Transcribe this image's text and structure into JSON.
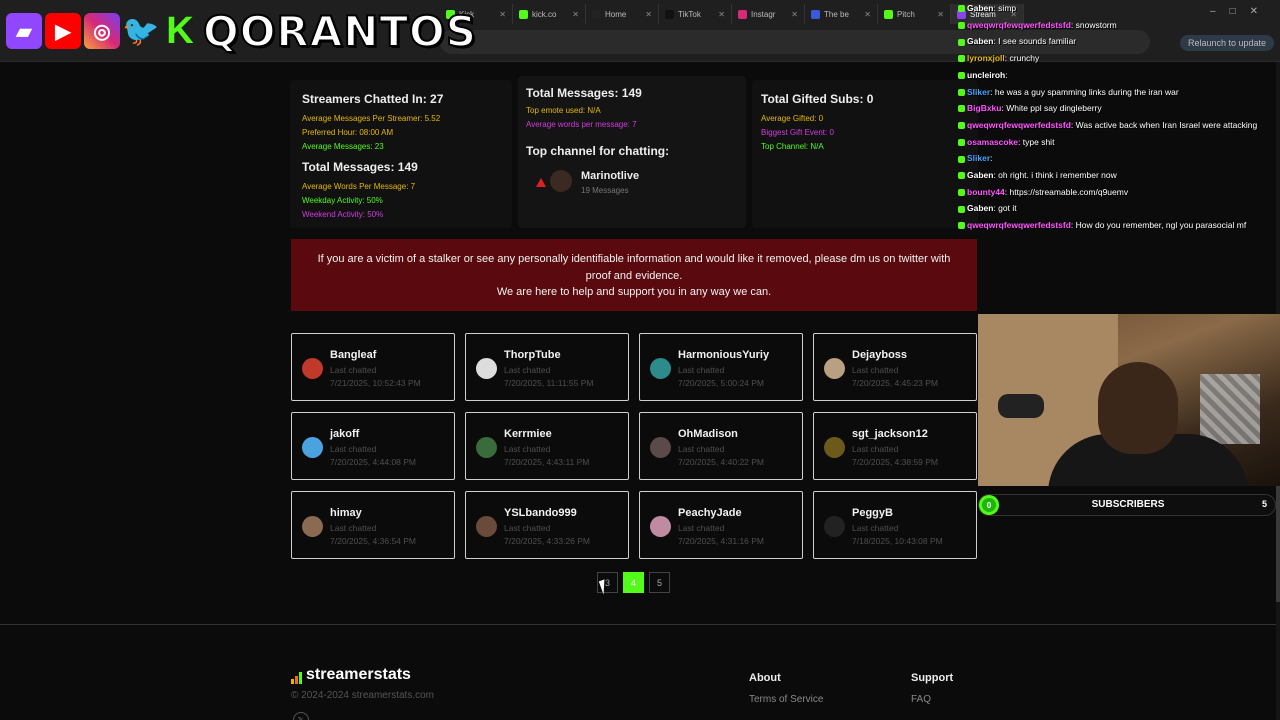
{
  "browser": {
    "tabs": [
      {
        "label": "Kick",
        "color": "#53fc18"
      },
      {
        "label": "kick.co",
        "color": "#53fc18"
      },
      {
        "label": "Home",
        "color": "#222222"
      },
      {
        "label": "TikTok",
        "color": "#111111"
      },
      {
        "label": "Instagr",
        "color": "#d62976"
      },
      {
        "label": "The be",
        "color": "#3a5bd9"
      },
      {
        "label": "Pitch",
        "color": "#53fc18"
      },
      {
        "label": "Stream",
        "color": "#8844ee"
      }
    ],
    "relaunch_label": "Relaunch to update"
  },
  "banner": {
    "handle": "QORANTOS",
    "icons": [
      "twitch-icon",
      "youtube-icon",
      "instagram-icon",
      "twitter-icon",
      "kick-icon"
    ]
  },
  "stats": {
    "clipped_top_left": "Streamers Chatted In: 27",
    "col1": {
      "title": "Streamers Chatted In: 27",
      "avg_msgs_per_streamer": "Average Messages Per Streamer: 5.52",
      "preferred_hour": "Preferred Hour: 08:00 AM",
      "avg_messages": "Average Messages: 23",
      "total_title": "Total Messages: 149",
      "avg_words": "Average Words Per Message: 7",
      "weekday": "Weekday Activity: 50%",
      "weekend": "Weekend Activity: 50%"
    },
    "col2": {
      "title": "Total Messages: 149",
      "top_emote": "Top emote used: N/A",
      "avg_words": "Average words per message: 7",
      "top_channel_title": "Top channel for chatting:",
      "top_channel_name": "Marinotlive",
      "top_channel_count": "19 Messages"
    },
    "col3": {
      "title": "Total Gifted Subs: 0",
      "avg_gifted": "Average Gifted: 0",
      "biggest_gift": "Biggest Gift Event: 0",
      "top_channel": "Top Channel: N/A"
    }
  },
  "notice": {
    "line1": "If you are a victim of a stalker or see any personally identifiable information and would like it removed, please dm us on twitter with",
    "line2": "proof and evidence.",
    "line3": "We are here to help and support you in any way we can."
  },
  "users": [
    {
      "name": "Bangleaf",
      "last": "Last chatted",
      "date": "7/21/2025, 10:52:43 PM",
      "avatar": "#c0392b"
    },
    {
      "name": "ThorpTube",
      "last": "Last chatted",
      "date": "7/20/2025, 11:11:55 PM",
      "avatar": "#dddddd"
    },
    {
      "name": "HarmoniousYuriy",
      "last": "Last chatted",
      "date": "7/20/2025, 5:00:24 PM",
      "avatar": "#2e8b8b"
    },
    {
      "name": "Dejayboss",
      "last": "Last chatted",
      "date": "7/20/2025, 4:45:23 PM",
      "avatar": "#b8a080"
    },
    {
      "name": "jakoff",
      "last": "Last chatted",
      "date": "7/20/2025, 4:44:08 PM",
      "avatar": "#4aa3df"
    },
    {
      "name": "Kerrmiee",
      "last": "Last chatted",
      "date": "7/20/2025, 4:43:11 PM",
      "avatar": "#3a6b3a"
    },
    {
      "name": "OhMadison",
      "last": "Last chatted",
      "date": "7/20/2025, 4:40:22 PM",
      "avatar": "#5a4a4a"
    },
    {
      "name": "sgt_jackson12",
      "last": "Last chatted",
      "date": "7/20/2025, 4:38:59 PM",
      "avatar": "#6b5a1a"
    },
    {
      "name": "himay",
      "last": "Last chatted",
      "date": "7/20/2025, 4:36:54 PM",
      "avatar": "#8a6a50"
    },
    {
      "name": "YSLbando999",
      "last": "Last chatted",
      "date": "7/20/2025, 4:33:26 PM",
      "avatar": "#6a4a3a"
    },
    {
      "name": "PeachyJade",
      "last": "Last chatted",
      "date": "7/20/2025, 4:31:16 PM",
      "avatar": "#c08aa0"
    },
    {
      "name": "PeggyB",
      "last": "Last chatted",
      "date": "7/18/2025, 10:43:08 PM",
      "avatar": "#222222"
    }
  ],
  "pagination": {
    "pages": [
      "3",
      "4",
      "5"
    ],
    "current": "4"
  },
  "footer": {
    "brand": "streamerstats",
    "copyright": "© 2024-2024 streamerstats.com",
    "about_title": "About",
    "about_link": "Terms of Service",
    "support_title": "Support",
    "support_link": "FAQ"
  },
  "chat": [
    {
      "user": "Gaben",
      "userColor": "#ffffff",
      "msg": ": simp"
    },
    {
      "user": "qweqwrqfewqwerfedstsfd",
      "userColor": "#ff55ff",
      "msg": ": snowstorm"
    },
    {
      "user": "Gaben",
      "userColor": "#ffffff",
      "msg": ": I see sounds familiar"
    },
    {
      "user": "lyronxjoll",
      "userColor": "#e6b800",
      "msg": ": crunchy"
    },
    {
      "user": "uncleiroh",
      "userColor": "#ffffff",
      "msg": ":"
    },
    {
      "user": "Sliker",
      "userColor": "#4aa3ff",
      "msg": ": he was a guy spamming links during the iran war"
    },
    {
      "user": "BigBxku",
      "userColor": "#ff55ff",
      "msg": ": White ppl say dingleberry"
    },
    {
      "user": "qweqwrqfewqwerfedstsfd",
      "userColor": "#ff55ff",
      "msg": ": Was active back when Iran Israel were attacking"
    },
    {
      "user": "osamascoke",
      "userColor": "#ff55ff",
      "msg": ": type shit"
    },
    {
      "user": "Sliker",
      "userColor": "#4aa3ff",
      "msg": ":"
    },
    {
      "user": "Gaben",
      "userColor": "#ffffff",
      "msg": ": oh right. i think i remember now"
    },
    {
      "user": "bounty44",
      "userColor": "#ff55ff",
      "msg": ": https://streamable.com/q9uemv"
    },
    {
      "user": "Gaben",
      "userColor": "#ffffff",
      "msg": ": got it"
    },
    {
      "user": "qweqwrqfewqwerfedstsfd",
      "userColor": "#ff55ff",
      "msg": ": How do you remember, ngl you parasocial mf"
    }
  ],
  "subs": {
    "current": "0",
    "label": "SUBSCRIBERS",
    "goal": "5",
    "progress_fraction": 0.0
  }
}
